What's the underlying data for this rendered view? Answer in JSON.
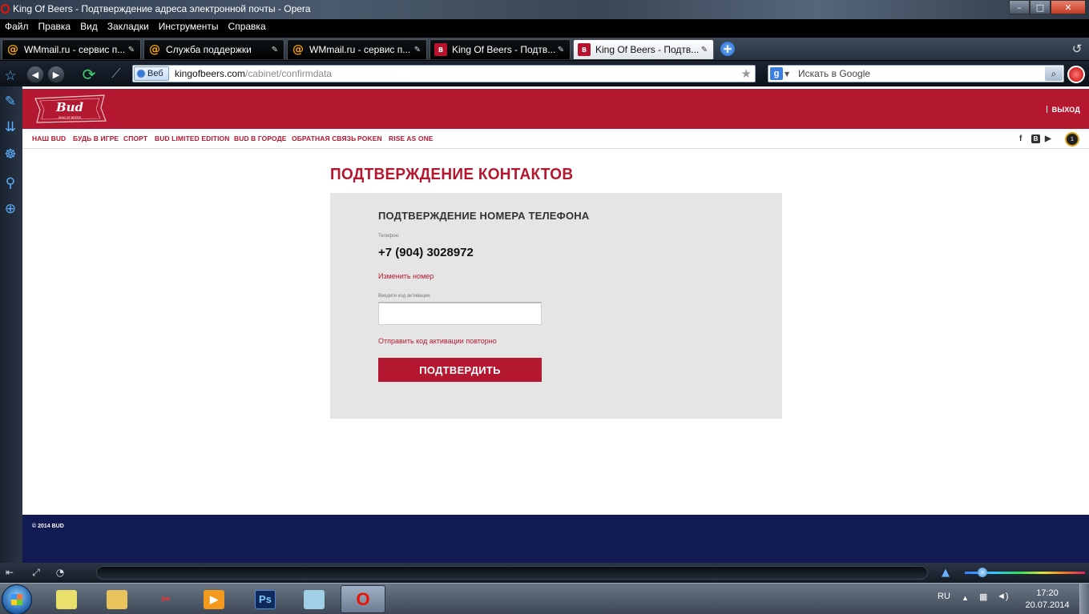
{
  "window": {
    "title": "King Of Beers - Подтверждение адреса электронной почты - Opera",
    "min": "–",
    "max": "□",
    "close": "✕"
  },
  "menu": [
    "Файл",
    "Правка",
    "Вид",
    "Закладки",
    "Инструменты",
    "Справка"
  ],
  "tabs": [
    {
      "label": "WMmail.ru - сервис п...",
      "icon": "at-icon",
      "active": false
    },
    {
      "label": "Служба поддержки",
      "icon": "at-icon",
      "active": false
    },
    {
      "label": "WMmail.ru - сервис п...",
      "icon": "at-icon",
      "active": false
    },
    {
      "label": "King Of Beers - Подтв...",
      "icon": "bud-icon",
      "active": false
    },
    {
      "label": "King Of Beers - Подтв...",
      "icon": "bud-icon",
      "active": true
    }
  ],
  "address": {
    "mode_label": "Веб",
    "domain": "kingofbeers.com",
    "path": "/cabinet/confirmdata"
  },
  "search": {
    "placeholder": "Искать в Google",
    "engine_letter": "g"
  },
  "site": {
    "logo_text": "Bud",
    "logo_subtext": "KING OF BEERS",
    "logout": "ВЫХОД",
    "nav": [
      "НАШ BUD",
      "БУДЬ В ИГРЕ",
      "СПОРТ",
      "BUD LIMITED EDITION",
      "BUD В ГОРОДЕ",
      "ОБРАТНАЯ СВЯЗЬ",
      "POKEN",
      "RISE AS ONE"
    ],
    "social": [
      "f",
      "B",
      "▶"
    ],
    "badge": "1",
    "footer": "© 2014 BUD"
  },
  "content": {
    "page_title": "ПОДТВЕРЖДЕНИЕ КОНТАКТОВ",
    "section_title": "ПОДТВЕРЖДЕНИЕ НОМЕРА ТЕЛЕФОНА",
    "phone_label": "Телефон:",
    "phone": "+7 (904) 3028972",
    "change_number": "Изменить номер",
    "code_label": "Введите код активации",
    "code_value": "",
    "resend": "Отправить код активации повторно",
    "submit": "ПОДТВЕРДИТЬ"
  },
  "taskbar": {
    "language": "RU",
    "time": "17:20",
    "date": "20.07.2014"
  },
  "colors": {
    "brand_red": "#b41830",
    "footer_navy": "#121a52",
    "card_gray": "#e5e5e5"
  }
}
